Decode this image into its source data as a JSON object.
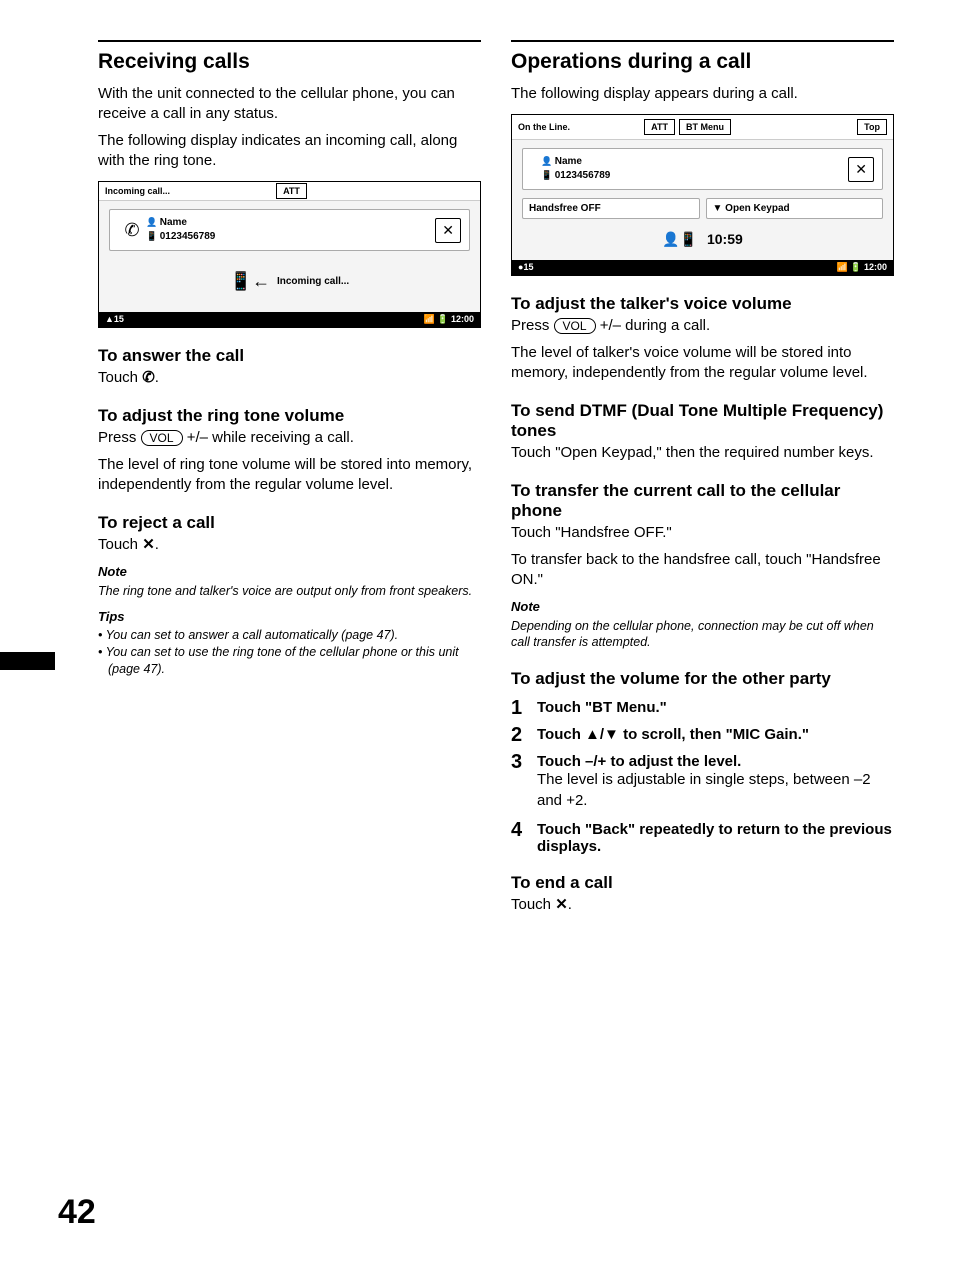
{
  "left": {
    "h1": "Receiving calls",
    "intro1": "With the unit connected to the cellular phone, you can receive a call in any status.",
    "intro2": "The following display indicates an incoming call, along with the ring tone.",
    "fig1": {
      "att": "ATT",
      "status": "Incoming call...",
      "name_label": "Name",
      "number": "0123456789",
      "center_text": "Incoming call...",
      "bottom_left": "15",
      "bottom_right": "12:00"
    },
    "h2_answer": "To answer the call",
    "answer_text_pre": "Touch ",
    "answer_text_post": ".",
    "h2_ringvol": "To adjust the ring tone volume",
    "ringvol_press_pre": "Press ",
    "vol_key": "VOL",
    "ringvol_press_post": " +/– while receiving a call.",
    "ringvol_body": "The level of ring tone volume will be stored into memory, independently from the regular volume level.",
    "h2_reject": "To reject a call",
    "reject_text_pre": "Touch ",
    "reject_text_post": ".",
    "note_label": "Note",
    "note_text": "The ring tone and talker's voice are output only from front speakers.",
    "tips_label": "Tips",
    "tip1": "You can set to answer a call automatically (page 47).",
    "tip2": "You can set to use the ring tone of the cellular phone or this unit (page 47)."
  },
  "right": {
    "h1": "Operations during a call",
    "intro": "The following display appears during a call.",
    "fig2": {
      "att": "ATT",
      "btmenu": "BT Menu",
      "top": "Top",
      "status": "On the Line.",
      "name_label": "Name",
      "number": "0123456789",
      "handsfree": "Handsfree OFF",
      "keypad": "▼ Open Keypad",
      "time": "10:59",
      "bottom_left": "15",
      "bottom_right": "12:00"
    },
    "h2_talkervol": "To adjust the talker's voice volume",
    "talkervol_press_pre": "Press ",
    "talkervol_press_post": " +/– during a call.",
    "talkervol_body": "The level of talker's voice volume will be stored into memory, independently from the regular volume level.",
    "h2_dtmf": "To send DTMF (Dual Tone Multiple Frequency) tones",
    "dtmf_body": "Touch \"Open Keypad,\" then the required number keys.",
    "h2_transfer": "To transfer the current call to the cellular phone",
    "transfer_body1": "Touch \"Handsfree OFF.\"",
    "transfer_body2": "To transfer back to the handsfree call, touch \"Handsfree ON.\"",
    "note_label": "Note",
    "note_text": "Depending on the cellular phone, connection may be cut off when call transfer is attempted.",
    "h2_othervol": "To adjust the volume for the other party",
    "step1": "Touch \"BT Menu.\"",
    "step2": "Touch ▲/▼ to scroll, then \"MIC Gain.\"",
    "step3_head": "Touch –/+ to adjust the level.",
    "step3_body": "The level is adjustable in single steps, between –2 and +2.",
    "step4": "Touch \"Back\" repeatedly to return to the previous displays.",
    "h2_end": "To end a call",
    "end_text_pre": "Touch ",
    "end_text_post": "."
  },
  "page_number": "42"
}
